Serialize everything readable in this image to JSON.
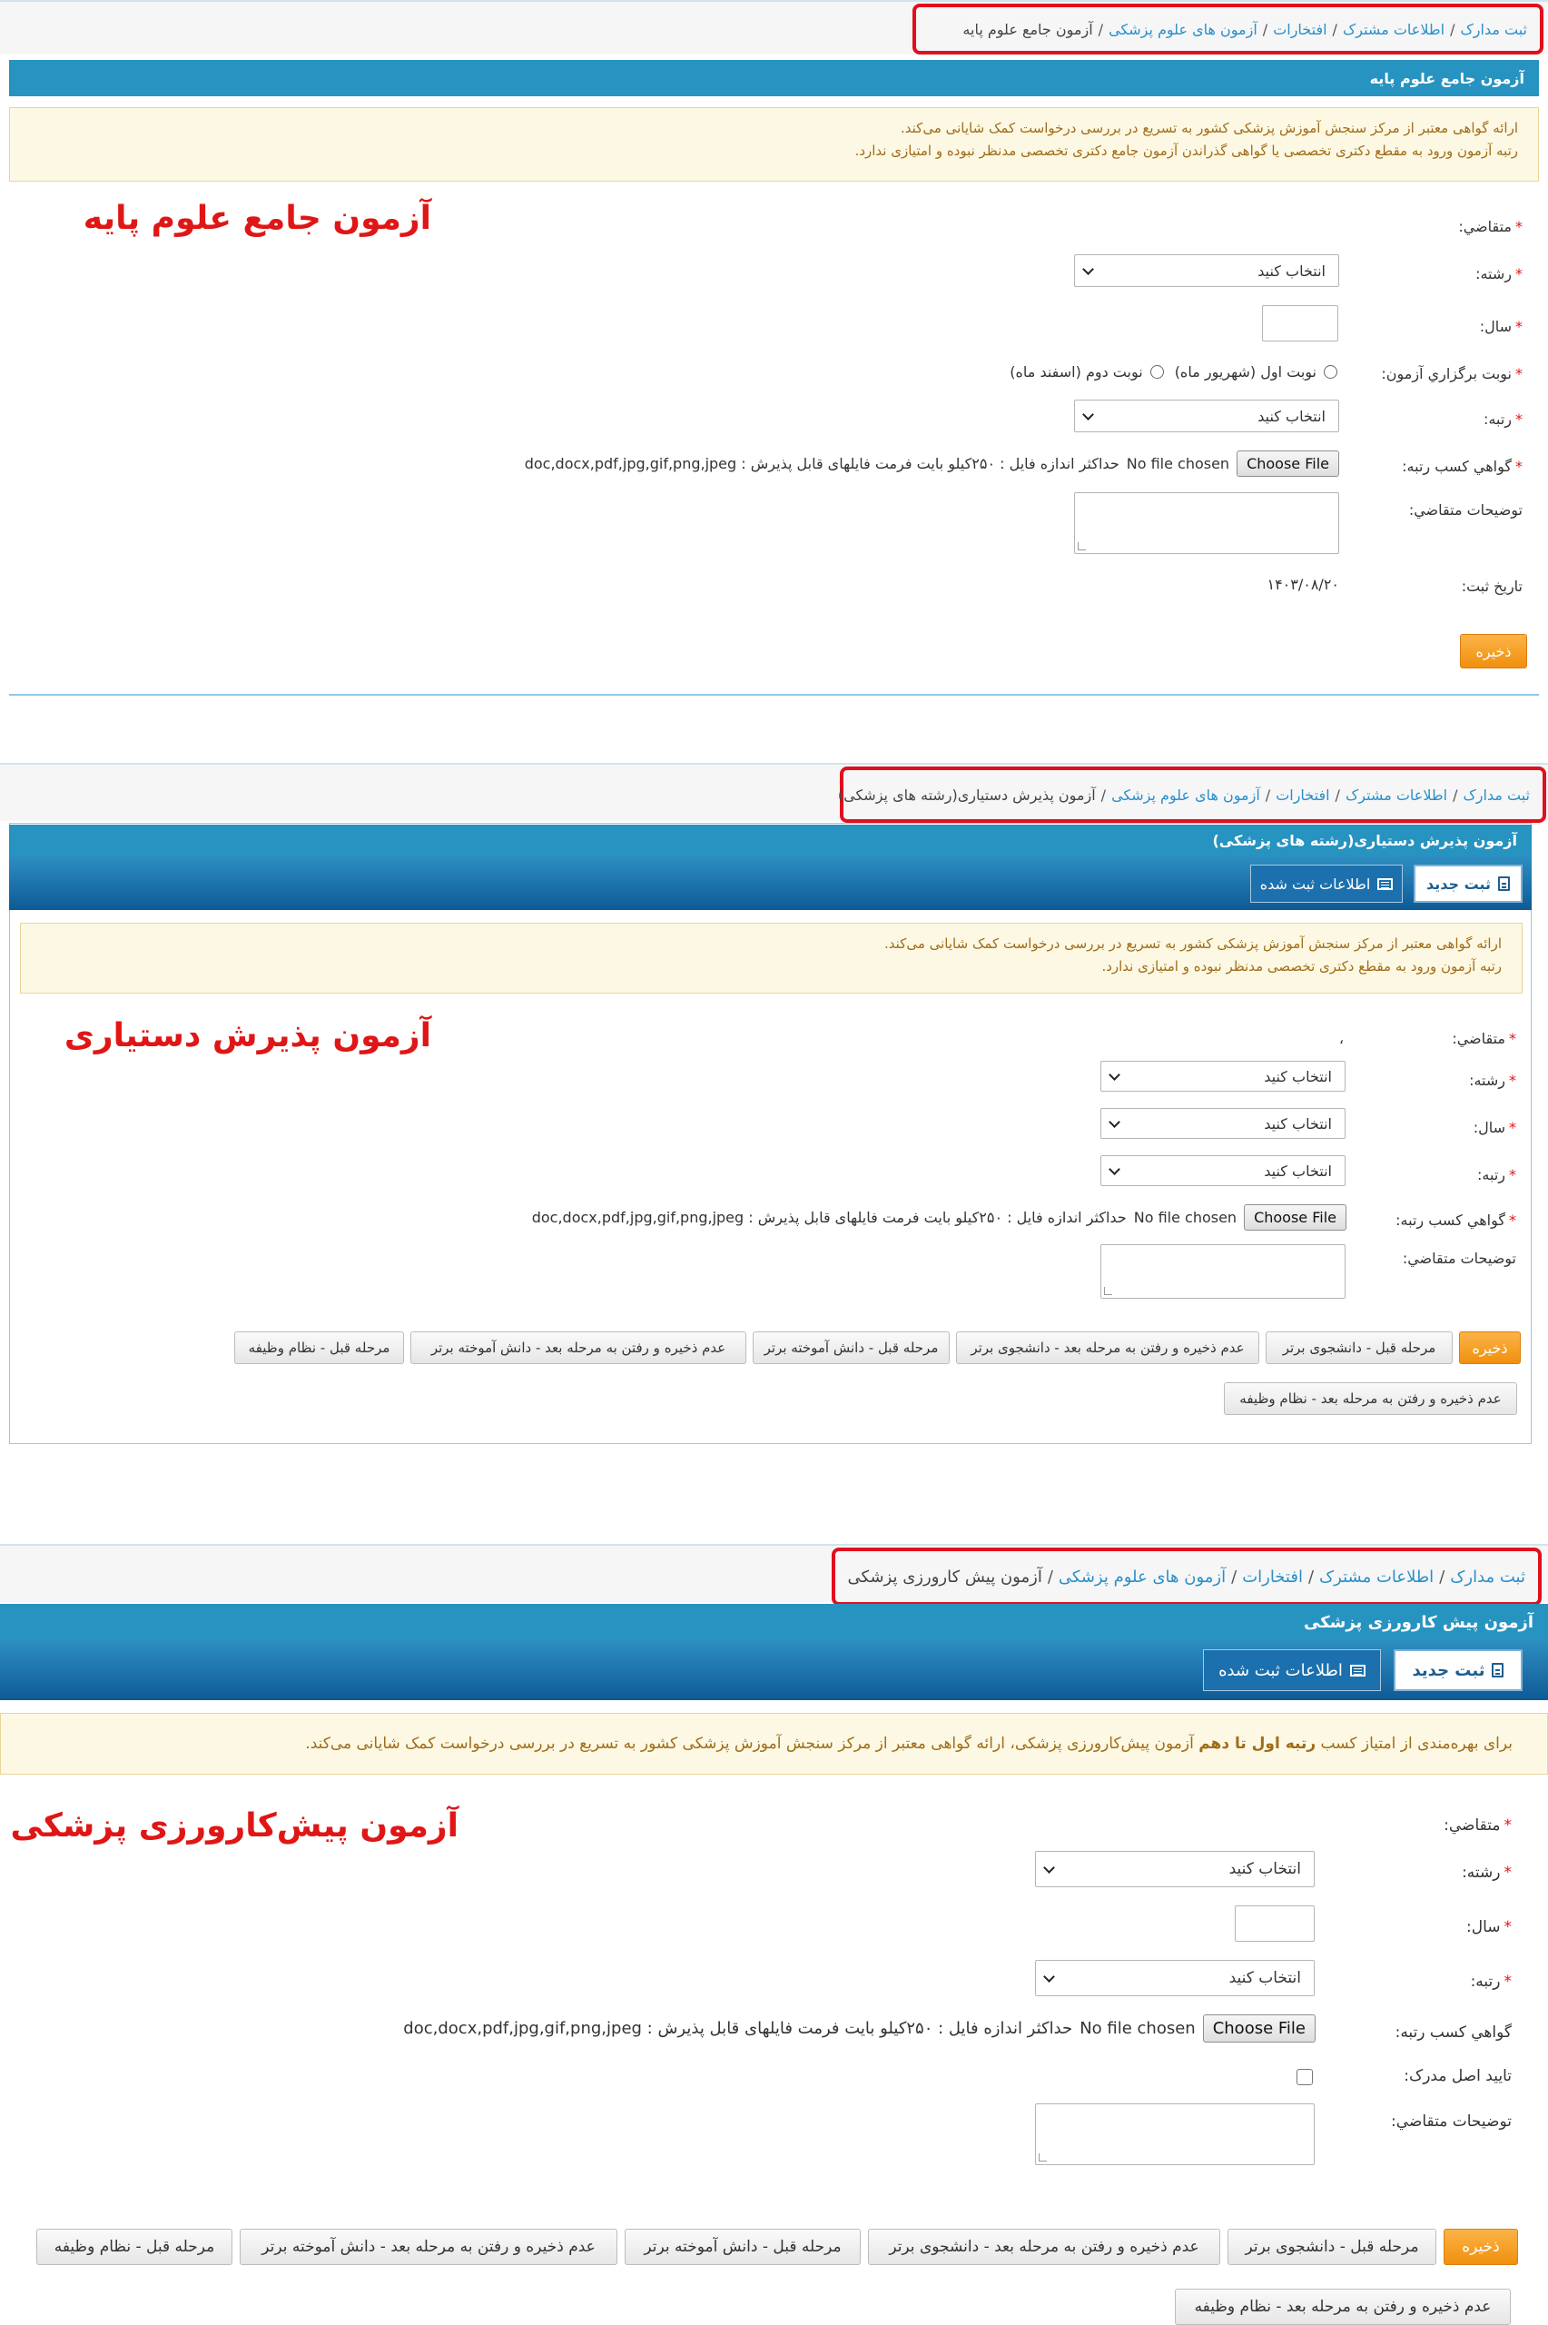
{
  "breadcrumb": {
    "home": "ثبت مدارک",
    "shared": "اطلاعات مشترک",
    "honors": "افتخارات",
    "medical": "آزمون های علوم پزشکی",
    "exam1": "آزمون جامع علوم پایه",
    "exam2": "آزمون پذیرش دستیاری(رشته های پزشکی)",
    "exam3": "آزمون پیش کارورزی پزشکی"
  },
  "panel1": {
    "header_title": "آزمون جامع علوم پایه",
    "alert_line1": "ارائه گواهی معتبر از مرکز سنجش آموزش پزشکی کشور به تسریع در بررسی درخواست کمک شایانی می‌کند.",
    "alert_line2": "رتبه آزمون ورود به مقطع دکتری تخصصی یا گواهی گذراندن آزمون جامع دکتری تخصصی مدنظر نبوده و امتیازی ندارد.",
    "big_title": "آزمون جامع علوم پایه",
    "label_applicant": "متقاضي:",
    "label_field": "رشته:",
    "label_year": "سال:",
    "label_round": "نوبت برگزاري آزمون:",
    "radio1": "نوبت اول (شهریور ماه)",
    "radio2": "نوبت دوم (اسفند ماه)",
    "label_rank": "رتبه:",
    "label_cert": "گواهي كسب رتبه:",
    "label_desc": "توضیحات متقاضي:",
    "label_date": "تاريخ ثبت:",
    "reg_date": "۱۴۰۳/۰۸/۲۰",
    "save": "ذخیره"
  },
  "panel2": {
    "header_title": "آزمون پذیرش دستیاری(رشته های پزشکی)",
    "tab_new": "ثبت جدید",
    "tab_saved": "اطلاعات ثبت شده",
    "alert_line1": "ارائه گواهی معتبر از مرکز سنجش آموزش پزشکی کشور به تسریع در بررسی درخواست کمک شایانی می‌کند.",
    "alert_line2": "رتبه آزمون ورود به مقطع دکتری تخصصی مدنظر نبوده و امتیازی ندارد.",
    "big_title": "آزمون پذیرش دستیاری",
    "label_applicant": "متقاضي:",
    "applicant_value": "،",
    "label_field": "رشته:",
    "label_year": "سال:",
    "label_rank": "رتبه:",
    "label_cert": "گواهي كسب رتبه:",
    "label_desc": "توضیحات متقاضي:",
    "save": "ذخیره",
    "btn_prev_top_student": "مرحله قبل - دانشجوی برتر",
    "btn_next_top_student": "عدم ذخیره و رفتن به مرحله بعد - دانشجوی برتر",
    "btn_prev_top_graduate": "مرحله قبل - دانش آموخته برتر",
    "btn_next_top_graduate": "عدم ذخیره و رفتن به مرحله بعد - دانش آموخته برتر",
    "btn_prev_military": "مرحله قبل - نظام وظیفه",
    "btn_next_military": "عدم ذخیره و رفتن به مرحله بعد - نظام وظیفه"
  },
  "panel3": {
    "header_title": "آزمون پیش کارورزی پزشکی",
    "tab_new": "ثبت جدید",
    "tab_saved": "اطلاعات ثبت شده",
    "alert_pre": "برای بهره‌مندی از امتیاز کسب ",
    "alert_bold": "رتبه اول تا دهم",
    "alert_post": " آزمون پیش‌کارورزی پزشکی، ارائه گواهی معتبر از مرکز سنجش آموزش پزشکی کشور به تسریع در بررسی درخواست کمک شایانی می‌کند.",
    "big_title": "آزمون پیش‌کارورزی پزشکی",
    "label_applicant": "متقاضي:",
    "label_field": "رشته:",
    "label_year": "سال:",
    "label_rank": "رتبه:",
    "label_cert": "گواهي كسب رتبه:",
    "label_original": "تاييد اصل مدرک:",
    "label_desc": "توضیحات متقاضي:",
    "save": "ذخیره",
    "btn_prev_top_student": "مرحله قبل - دانشجوی برتر",
    "btn_next_top_student": "عدم ذخیره و رفتن به مرحله بعد - دانشجوی برتر",
    "btn_prev_top_graduate": "مرحله قبل - دانش آموخته برتر",
    "btn_next_top_graduate": "عدم ذخیره و رفتن به مرحله بعد - دانش آموخته برتر",
    "btn_prev_military": "مرحله قبل - نظام وظیفه",
    "btn_next_military": "عدم ذخیره و رفتن به مرحله بعد - نظام وظیفه"
  },
  "common": {
    "select_placeholder": "انتخاب کنید",
    "choose_file": "Choose File",
    "no_file": "No file chosen",
    "file_note": "حداکثر اندازه فایل : ۲۵۰کیلو بایت فرمت فایلهای قابل پذیرش : doc,docx,pdf,jpg,gif,png,jpeg"
  },
  "colors": {
    "header_blue": "#2793c0",
    "required_red": "#e01616",
    "save_orange": "#f0900e",
    "alert_bg": "#fcf8e3"
  }
}
